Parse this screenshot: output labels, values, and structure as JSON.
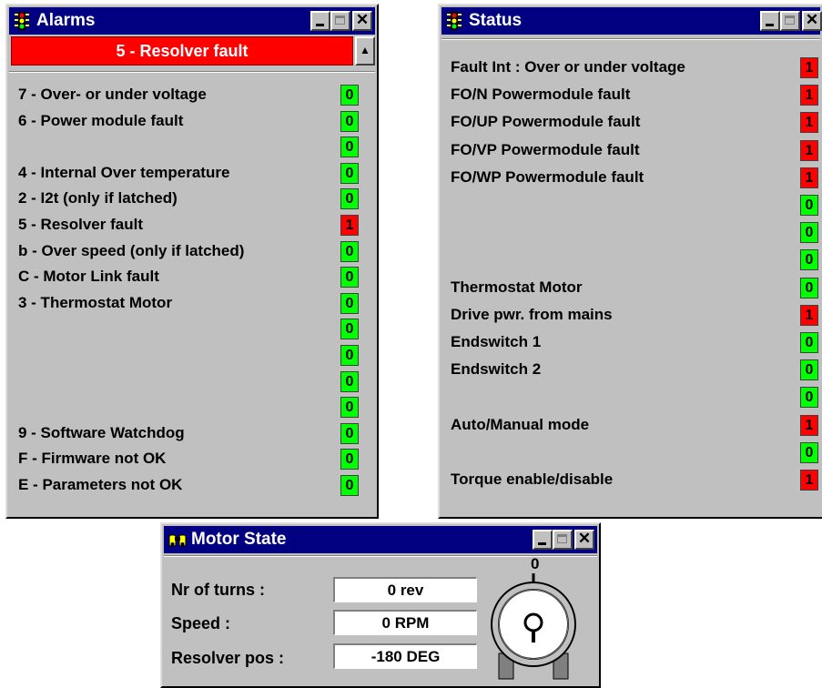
{
  "alarms": {
    "title": "Alarms",
    "active_alarm": "5 - Resolver fault",
    "scroll_up_glyph": "▲",
    "rows": [
      {
        "label": "7 - Over- or under voltage",
        "value": "0",
        "state": "ok"
      },
      {
        "label": "6 - Power module fault",
        "value": "0",
        "state": "ok"
      },
      {
        "label": "",
        "value": "0",
        "state": "ok"
      },
      {
        "label": "4 - Internal Over temperature",
        "value": "0",
        "state": "ok"
      },
      {
        "label": "2 - I2t (only if latched)",
        "value": "0",
        "state": "ok"
      },
      {
        "label": "5 - Resolver fault",
        "value": "1",
        "state": "fault"
      },
      {
        "label": "b - Over speed (only if latched)",
        "value": "0",
        "state": "ok"
      },
      {
        "label": "C - Motor Link fault",
        "value": "0",
        "state": "ok"
      },
      {
        "label": "3 - Thermostat Motor",
        "value": "0",
        "state": "ok"
      },
      {
        "label": "",
        "value": "0",
        "state": "ok"
      },
      {
        "label": "",
        "value": "0",
        "state": "ok"
      },
      {
        "label": "",
        "value": "0",
        "state": "ok"
      },
      {
        "label": "",
        "value": "0",
        "state": "ok"
      },
      {
        "label": "9 - Software Watchdog",
        "value": "0",
        "state": "ok"
      },
      {
        "label": "F - Firmware not OK",
        "value": "0",
        "state": "ok"
      },
      {
        "label": "E - Parameters not OK",
        "value": "0",
        "state": "ok"
      }
    ]
  },
  "status": {
    "title": "Status",
    "rows": [
      {
        "label": "Fault Int : Over or under voltage",
        "value": "1",
        "state": "fault"
      },
      {
        "label": "FO/N Powermodule fault",
        "value": "1",
        "state": "fault"
      },
      {
        "label": "FO/UP Powermodule fault",
        "value": "1",
        "state": "fault"
      },
      {
        "label": "FO/VP Powermodule fault",
        "value": "1",
        "state": "fault"
      },
      {
        "label": "FO/WP Powermodule fault",
        "value": "1",
        "state": "fault"
      },
      {
        "label": "",
        "value": "0",
        "state": "ok"
      },
      {
        "label": "",
        "value": "0",
        "state": "ok"
      },
      {
        "label": "",
        "value": "0",
        "state": "ok"
      },
      {
        "label": "Thermostat Motor",
        "value": "0",
        "state": "ok"
      },
      {
        "label": "Drive pwr. from mains",
        "value": "1",
        "state": "fault"
      },
      {
        "label": "Endswitch 1",
        "value": "0",
        "state": "ok"
      },
      {
        "label": "Endswitch 2",
        "value": "0",
        "state": "ok"
      },
      {
        "label": "",
        "value": "0",
        "state": "ok"
      },
      {
        "label": "Auto/Manual mode",
        "value": "1",
        "state": "fault"
      },
      {
        "label": "",
        "value": "0",
        "state": "ok"
      },
      {
        "label": "Torque enable/disable",
        "value": "1",
        "state": "fault"
      }
    ]
  },
  "motor_state": {
    "title": "Motor State",
    "turns_label": "Nr of turns :",
    "turns_value": "0 rev",
    "speed_label": "Speed :",
    "speed_value": "0 RPM",
    "resolver_label": "Resolver pos :",
    "resolver_value": "-180 DEG",
    "dial_zero_label": "0"
  },
  "window_controls": {
    "close_glyph": "✕"
  },
  "colors": {
    "ok": "#00ff00",
    "fault": "#ff0000",
    "titlebar": "#000080",
    "window": "#c0c0c0"
  }
}
